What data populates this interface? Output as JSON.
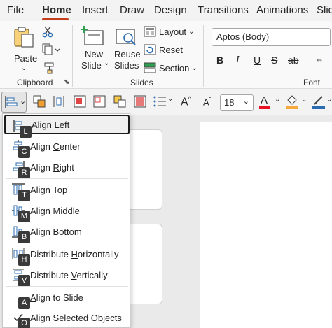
{
  "tabs": [
    "File",
    "Home",
    "Insert",
    "Draw",
    "Design",
    "Transitions",
    "Animations",
    "Slid"
  ],
  "active_tab": "Home",
  "accent_color": "#c43e1c",
  "clipboard": {
    "paste_label": "Paste",
    "group_label": "Clipboard"
  },
  "slides": {
    "new_slide_line1": "New",
    "new_slide_line2": "Slide",
    "reuse_line1": "Reuse",
    "reuse_line2": "Slides",
    "layout_label": "Layout",
    "reset_label": "Reset",
    "section_label": "Section",
    "group_label": "Slides"
  },
  "font": {
    "font_name": "Aptos (Body)",
    "bold": "B",
    "italic": "I",
    "underline": "U",
    "strike": "S",
    "abc": "ab",
    "group_label": "Font",
    "font_size": "18",
    "font_color": "#e81123",
    "highlight_color": "#f7a93b"
  },
  "arrange_menu": {
    "items": [
      {
        "pre": "Align ",
        "ul": "L",
        "post": "eft",
        "keytip": "L",
        "icon": "align-left-icon"
      },
      {
        "pre": "Align ",
        "ul": "C",
        "post": "enter",
        "keytip": "C",
        "icon": "align-center-icon"
      },
      {
        "pre": "Align ",
        "ul": "R",
        "post": "ight",
        "keytip": "R",
        "icon": "align-right-icon"
      },
      {
        "pre": "Align ",
        "ul": "T",
        "post": "op",
        "keytip": "T",
        "icon": "align-top-icon"
      },
      {
        "pre": "Align ",
        "ul": "M",
        "post": "iddle",
        "keytip": "M",
        "icon": "align-middle-icon"
      },
      {
        "pre": "Align ",
        "ul": "B",
        "post": "ottom",
        "keytip": "B",
        "icon": "align-bottom-icon"
      },
      {
        "pre": "Distribute ",
        "ul": "H",
        "post": "orizontally",
        "keytip": "H",
        "icon": "distribute-horizontal-icon"
      },
      {
        "pre": "Distribute ",
        "ul": "V",
        "post": "ertically",
        "keytip": "V",
        "icon": "distribute-vertical-icon"
      },
      {
        "pre": "",
        "ul": "A",
        "post": "lign to Slide",
        "keytip": "A",
        "icon": ""
      },
      {
        "pre": "Align Selected ",
        "ul": "O",
        "post": "bjects",
        "keytip": "O",
        "icon": "checkmark-icon"
      }
    ]
  }
}
